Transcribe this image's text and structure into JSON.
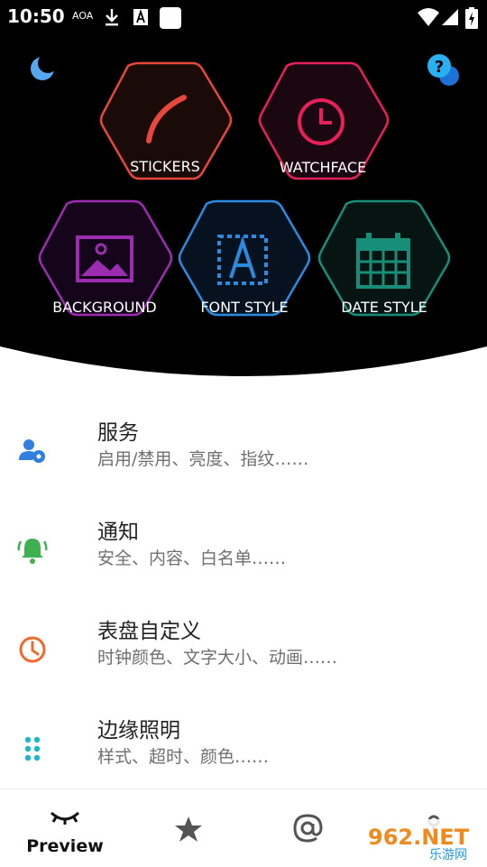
{
  "status_bar": {
    "time": "10:50",
    "aoa": "AOA"
  },
  "hero": {
    "tiles": [
      {
        "label": "STICKERS",
        "color": "#e8473c",
        "icon": "arc-sticker-icon"
      },
      {
        "label": "WATCHFACE",
        "color": "#e5205a",
        "icon": "clock-icon"
      },
      {
        "label": "BACKGROUND",
        "color": "#9c2cb0",
        "icon": "image-icon"
      },
      {
        "label": "FONT STYLE",
        "color": "#2a8be0",
        "icon": "font-icon"
      },
      {
        "label": "DATE STYLE",
        "color": "#178e79",
        "icon": "calendar-icon"
      }
    ],
    "top_left_icon": "moon-icon",
    "top_right_icon": "help-chat-icon"
  },
  "menu": {
    "items": [
      {
        "title": "服务",
        "subtitle": "启用/禁用、亮度、指纹……",
        "icon": "user-settings-icon",
        "color": "#2f7fe0"
      },
      {
        "title": "通知",
        "subtitle": "安全、内容、白名单……",
        "icon": "bell-icon",
        "color": "#3fb04f"
      },
      {
        "title": "表盘自定义",
        "subtitle": "时钟颜色、文字大小、动画……",
        "icon": "clock-outline-icon",
        "color": "#ef6a2e"
      },
      {
        "title": "边缘照明",
        "subtitle": "样式、超时、颜色……",
        "icon": "dots-grid-icon",
        "color": "#1fb6c8"
      }
    ]
  },
  "bottom_nav": {
    "preview_label": "Preview",
    "items": [
      "eye-closed-icon",
      "star-icon",
      "at-icon",
      "key-icon"
    ]
  },
  "watermark": {
    "text_large": "962.NET",
    "text_small": "乐游网"
  }
}
